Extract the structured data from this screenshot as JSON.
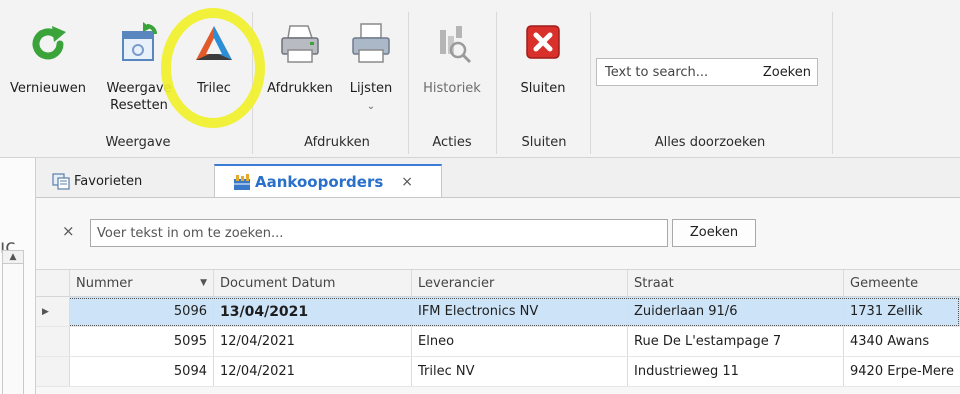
{
  "ribbon": {
    "buttons": {
      "refresh": "Vernieuwen",
      "reset_view_line1": "Weergave",
      "reset_view_line2": "Resetten",
      "trilec": "Trilec",
      "print": "Afdrukken",
      "lists": "Lijsten",
      "history": "Historiek",
      "close": "Sluiten"
    },
    "groups": {
      "view": "Weergave",
      "print": "Afdrukken",
      "actions": "Acties",
      "close": "Sluiten",
      "search_all": "Alles doorzoeken"
    },
    "search": {
      "placeholder": "Text to search...",
      "button": "Zoeken"
    }
  },
  "tabs": {
    "favorites": "Favorieten",
    "purchase_orders": "Aankooporders",
    "close_glyph": "×"
  },
  "filter": {
    "clear_glyph": "×",
    "placeholder": "Voer tekst in om te zoeken...",
    "button": "Zoeken"
  },
  "left_strip": {
    "cut_text": "ıç"
  },
  "table": {
    "columns": [
      "Nummer",
      "Document Datum",
      "Leverancier",
      "Straat",
      "Gemeente"
    ],
    "rows": [
      {
        "number": "5096",
        "date": "13/04/2021",
        "supplier": "IFM Electronics NV",
        "street": "Zuiderlaan 91/6",
        "city": "1731 Zellik"
      },
      {
        "number": "5095",
        "date": "12/04/2021",
        "supplier": "Elneo",
        "street": "Rue De L'estampage 7",
        "city": "4340 Awans"
      },
      {
        "number": "5094",
        "date": "12/04/2021",
        "supplier": "Trilec NV",
        "street": "Industrieweg 11",
        "city": "9420 Erpe-Mere"
      }
    ]
  },
  "colors": {
    "accent_tab": "#2a6fc9",
    "selected_row": "#cde3f7",
    "highlight": "#f1f02a",
    "close_red": "#d9302c",
    "refresh_green": "#3aa33a"
  }
}
